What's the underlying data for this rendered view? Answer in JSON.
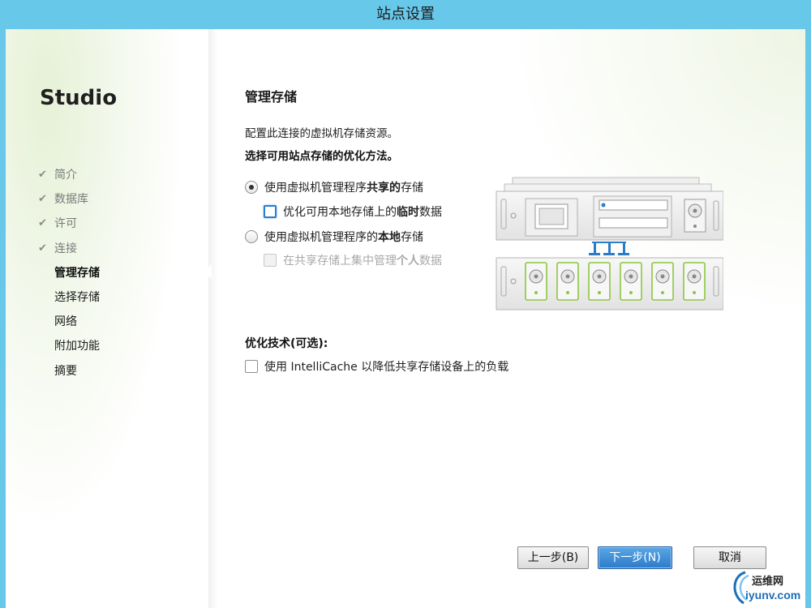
{
  "window": {
    "title": "站点设置"
  },
  "sidebar": {
    "brand": "Studio",
    "items": [
      {
        "label": "简介",
        "state": "done"
      },
      {
        "label": "数据库",
        "state": "done"
      },
      {
        "label": "许可",
        "state": "done"
      },
      {
        "label": "连接",
        "state": "done"
      },
      {
        "label": "管理存储",
        "state": "active"
      },
      {
        "label": "选择存储",
        "state": "todo"
      },
      {
        "label": "网络",
        "state": "todo"
      },
      {
        "label": "附加功能",
        "state": "todo"
      },
      {
        "label": "摘要",
        "state": "todo"
      }
    ],
    "check_glyph": "✔"
  },
  "main": {
    "title": "管理存储",
    "description": "配置此连接的虚拟机存储资源。",
    "prompt": "选择可用站点存储的优化方法。",
    "option_shared": {
      "text_before": "使用虚拟机管理程序",
      "text_bold": "共享的",
      "text_after": "存储",
      "selected": true
    },
    "option_shared_temp": {
      "text_before": "优化可用本地存储上的",
      "text_bold": "临时",
      "text_after": "数据",
      "checked": false
    },
    "option_local": {
      "text_before": "使用虚拟机管理程序的",
      "text_bold": "本地",
      "text_after": "存储",
      "selected": false
    },
    "option_local_personal": {
      "text_before": "在共享存储上集中管理",
      "text_bold": "个人",
      "text_after": "数据",
      "checked": false,
      "enabled": false
    },
    "optimization_title": "优化技术(可选):",
    "intellicache_label": "使用 IntelliCache 以降低共享存储设备上的负载"
  },
  "buttons": {
    "back": "上一步(B)",
    "next": "下一步(N)",
    "cancel": "取消"
  },
  "watermark": {
    "cn": "运维网",
    "url": "iyunv.com"
  },
  "colors": {
    "titlebar": "#68c8ea",
    "primary_button": "#2c7ac9",
    "disk_green": "#8cc63f",
    "link_blue": "#1f6eb8"
  }
}
